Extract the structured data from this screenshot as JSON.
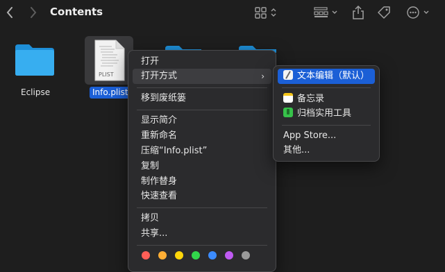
{
  "window": {
    "title": "Contents"
  },
  "toolbar": {
    "back_icon": "chevron-left-icon",
    "forward_icon": "chevron-right-icon",
    "view_icon": "grid-view-icon",
    "group_icon": "group-by-icon",
    "share_icon": "share-icon",
    "tag_icon": "tag-icon",
    "more_icon": "ellipsis-circle-icon"
  },
  "files": [
    {
      "name": "Eclipse",
      "type": "folder"
    },
    {
      "name": "Info.plist",
      "type": "plist",
      "selected": true,
      "thumb_text": "PLIST"
    }
  ],
  "context_menu": {
    "items": [
      {
        "label": "打开"
      },
      {
        "label": "打开方式",
        "has_submenu": true
      },
      {
        "label": "移到废纸篓"
      },
      {
        "label": "显示简介"
      },
      {
        "label": "重新命名"
      },
      {
        "label": "压缩“Info.plist”"
      },
      {
        "label": "复制"
      },
      {
        "label": "制作替身"
      },
      {
        "label": "快速查看"
      },
      {
        "label": "拷贝"
      },
      {
        "label": "共享..."
      }
    ],
    "tag_colors": [
      "#ff5f57",
      "#ffae35",
      "#ffd60a",
      "#32d74b",
      "#3c8cff",
      "#bf5af2",
      "#9a9a9a"
    ]
  },
  "open_with_submenu": {
    "items": [
      {
        "label": "文本编辑（默认）",
        "icon": "textedit-icon",
        "selected": true
      },
      {
        "label": "备忘录",
        "icon": "notes-icon"
      },
      {
        "label": "归档实用工具",
        "icon": "archive-utility-icon"
      },
      {
        "label": "App Store..."
      },
      {
        "label": "其他..."
      }
    ]
  }
}
